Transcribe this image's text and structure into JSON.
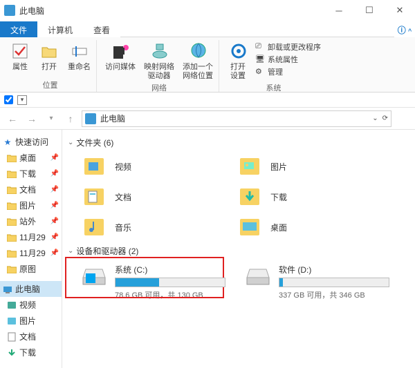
{
  "window": {
    "title": "此电脑"
  },
  "tabs": {
    "file": "文件",
    "computer": "计算机",
    "view": "查看"
  },
  "ribbon": {
    "group_location": {
      "label": "位置",
      "properties": "属性",
      "open": "打开",
      "rename": "重命名"
    },
    "group_network": {
      "label": "网络",
      "media": "访问媒体",
      "map_drive": "映射网络\n驱动器",
      "add_location": "添加一个\n网络位置"
    },
    "group_system": {
      "label": "系统",
      "open_settings": "打开\n设置",
      "uninstall": "卸载或更改程序",
      "sys_props": "系统属性",
      "manage": "管理"
    }
  },
  "address": {
    "path": "此电脑"
  },
  "sidebar": {
    "quick_access": "快速访问",
    "items": [
      {
        "label": "桌面",
        "pin": true
      },
      {
        "label": "下载",
        "pin": true
      },
      {
        "label": "文档",
        "pin": true
      },
      {
        "label": "图片",
        "pin": true
      },
      {
        "label": "站外",
        "pin": true
      },
      {
        "label": "11月29",
        "pin": true
      },
      {
        "label": "11月29",
        "pin": true
      },
      {
        "label": "原图",
        "pin": false
      }
    ],
    "this_pc": "此电脑",
    "pc_items": [
      {
        "label": "视频"
      },
      {
        "label": "图片"
      },
      {
        "label": "文档"
      },
      {
        "label": "下载"
      }
    ]
  },
  "content": {
    "folders_header": "文件夹 (6)",
    "folders": [
      {
        "label": "视频"
      },
      {
        "label": "图片"
      },
      {
        "label": "文档"
      },
      {
        "label": "下载"
      },
      {
        "label": "音乐"
      },
      {
        "label": "桌面"
      }
    ],
    "drives_header": "设备和驱动器 (2)",
    "drives": [
      {
        "name": "系统 (C:)",
        "free": "78.6 GB 可用，共 130 GB",
        "fill_pct": 40,
        "os": true
      },
      {
        "name": "软件 (D:)",
        "free": "337 GB 可用，共 346 GB",
        "fill_pct": 3,
        "os": false
      }
    ]
  }
}
